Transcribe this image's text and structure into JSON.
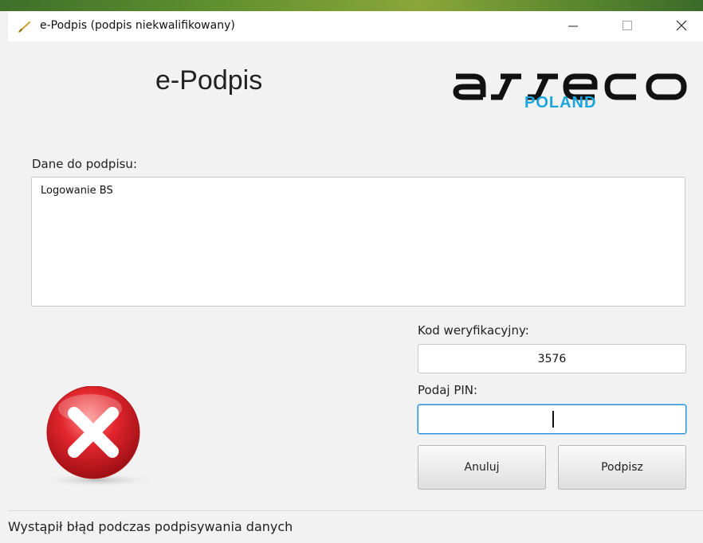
{
  "window": {
    "title": "e-Podpis (podpis niekwalifikowany)",
    "icon": "feather-pen-icon",
    "controls": {
      "minimize": "─",
      "maximize": "☐",
      "close": "✕"
    }
  },
  "header": {
    "title": "e-Podpis",
    "brand_logo_text": "asseco",
    "brand_subtitle": "POLAND",
    "brand_color": "#1aa5dc"
  },
  "form": {
    "data_label": "Dane do podpisu:",
    "data_value": "Logowanie BS",
    "code_label": "Kod weryfikacyjny:",
    "code_value": "3576",
    "pin_label": "Podaj PIN:",
    "pin_value": "",
    "cancel_label": "Anuluj",
    "sign_label": "Podpisz"
  },
  "status": {
    "icon": "error-x-icon",
    "message": "Wystąpił błąd podczas podpisywania danych",
    "error_color": "#e0232a"
  }
}
